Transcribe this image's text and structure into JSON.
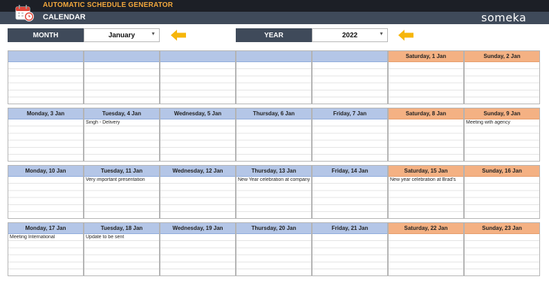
{
  "header": {
    "app_title": "AUTOMATIC SCHEDULE GENERATOR",
    "page_title": "CALENDAR",
    "brand": "someka"
  },
  "icons": {
    "app": "calendar-clock-icon",
    "month_arrow": "arrow-left-icon",
    "year_arrow": "arrow-left-icon",
    "dropdown": "chevron-down-icon"
  },
  "colors": {
    "header_dark": "#1c1f26",
    "header_slate": "#3f4a5a",
    "accent_orange": "#f4a93d",
    "weekday_header": "#b4c6e7",
    "weekend_header": "#f4b183"
  },
  "controls": {
    "month_label": "MONTH",
    "month_value": "January",
    "year_label": "YEAR",
    "year_value": "2022"
  },
  "weeks": [
    {
      "days": [
        {
          "label": "",
          "event": ""
        },
        {
          "label": "",
          "event": ""
        },
        {
          "label": "",
          "event": ""
        },
        {
          "label": "",
          "event": ""
        },
        {
          "label": "",
          "event": ""
        },
        {
          "label": "Saturday, 1 Jan",
          "event": ""
        },
        {
          "label": "Sunday, 2 Jan",
          "event": ""
        }
      ]
    },
    {
      "days": [
        {
          "label": "Monday, 3 Jan",
          "event": ""
        },
        {
          "label": "Tuesday, 4 Jan",
          "event": "Singh - Delivery"
        },
        {
          "label": "Wednesday, 5 Jan",
          "event": ""
        },
        {
          "label": "Thursday, 6 Jan",
          "event": ""
        },
        {
          "label": "Friday, 7 Jan",
          "event": ""
        },
        {
          "label": "Saturday, 8 Jan",
          "event": ""
        },
        {
          "label": "Sunday, 9 Jan",
          "event": "Meeting with agency"
        }
      ]
    },
    {
      "days": [
        {
          "label": "Monday, 10 Jan",
          "event": ""
        },
        {
          "label": "Tuesday, 11 Jan",
          "event": "Very important presentation"
        },
        {
          "label": "Wednesday, 12 Jan",
          "event": ""
        },
        {
          "label": "Thursday, 13 Jan",
          "event": "New Year celebration at company"
        },
        {
          "label": "Friday, 14 Jan",
          "event": ""
        },
        {
          "label": "Saturday, 15 Jan",
          "event": "New year celebration at Brad's"
        },
        {
          "label": "Sunday, 16 Jan",
          "event": ""
        }
      ]
    },
    {
      "days": [
        {
          "label": "Monday, 17 Jan",
          "event": "Meeting International"
        },
        {
          "label": "Tuesday, 18 Jan",
          "event": "Update to be sent"
        },
        {
          "label": "Wednesday, 19 Jan",
          "event": ""
        },
        {
          "label": "Thursday, 20 Jan",
          "event": ""
        },
        {
          "label": "Friday, 21 Jan",
          "event": ""
        },
        {
          "label": "Saturday, 22 Jan",
          "event": ""
        },
        {
          "label": "Sunday, 23 Jan",
          "event": ""
        }
      ]
    }
  ]
}
